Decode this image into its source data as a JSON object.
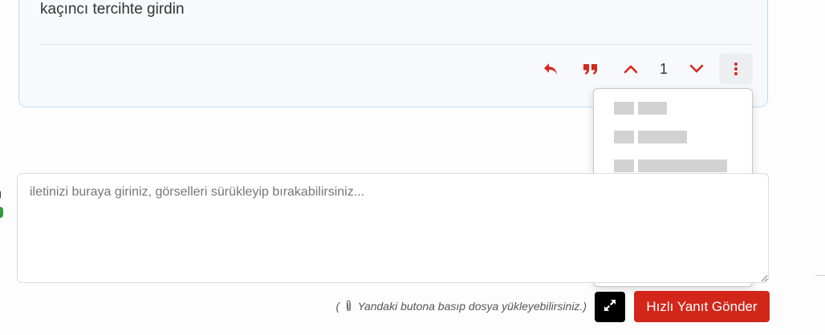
{
  "post": {
    "text": "kaçıncı tercihte girdin",
    "vote_count": "1"
  },
  "icons": {
    "reply": "reply-icon",
    "quote": "quote-icon",
    "upvote": "chevron-up-icon",
    "downvote": "chevron-down-icon",
    "more": "vertical-ellipsis-icon",
    "attach": "paperclip-icon",
    "expand": "expand-icon"
  },
  "menu": {
    "items": [
      {
        "label": ""
      },
      {
        "label": ""
      },
      {
        "label": ""
      },
      {
        "label": ""
      },
      {
        "label": ""
      },
      {
        "label": ""
      }
    ]
  },
  "reply": {
    "placeholder": "iletinizi buraya giriniz, görselleri sürükleyip bırakabilirsiniz..."
  },
  "footer": {
    "hint_open": "(",
    "hint_text": "Yandaki butona basıp dosya yükleyebilirsiniz.)",
    "send_label": "Hızlı Yanıt Gönder"
  },
  "colors": {
    "accent": "#d2261a",
    "card_border": "#b9dcf5"
  }
}
